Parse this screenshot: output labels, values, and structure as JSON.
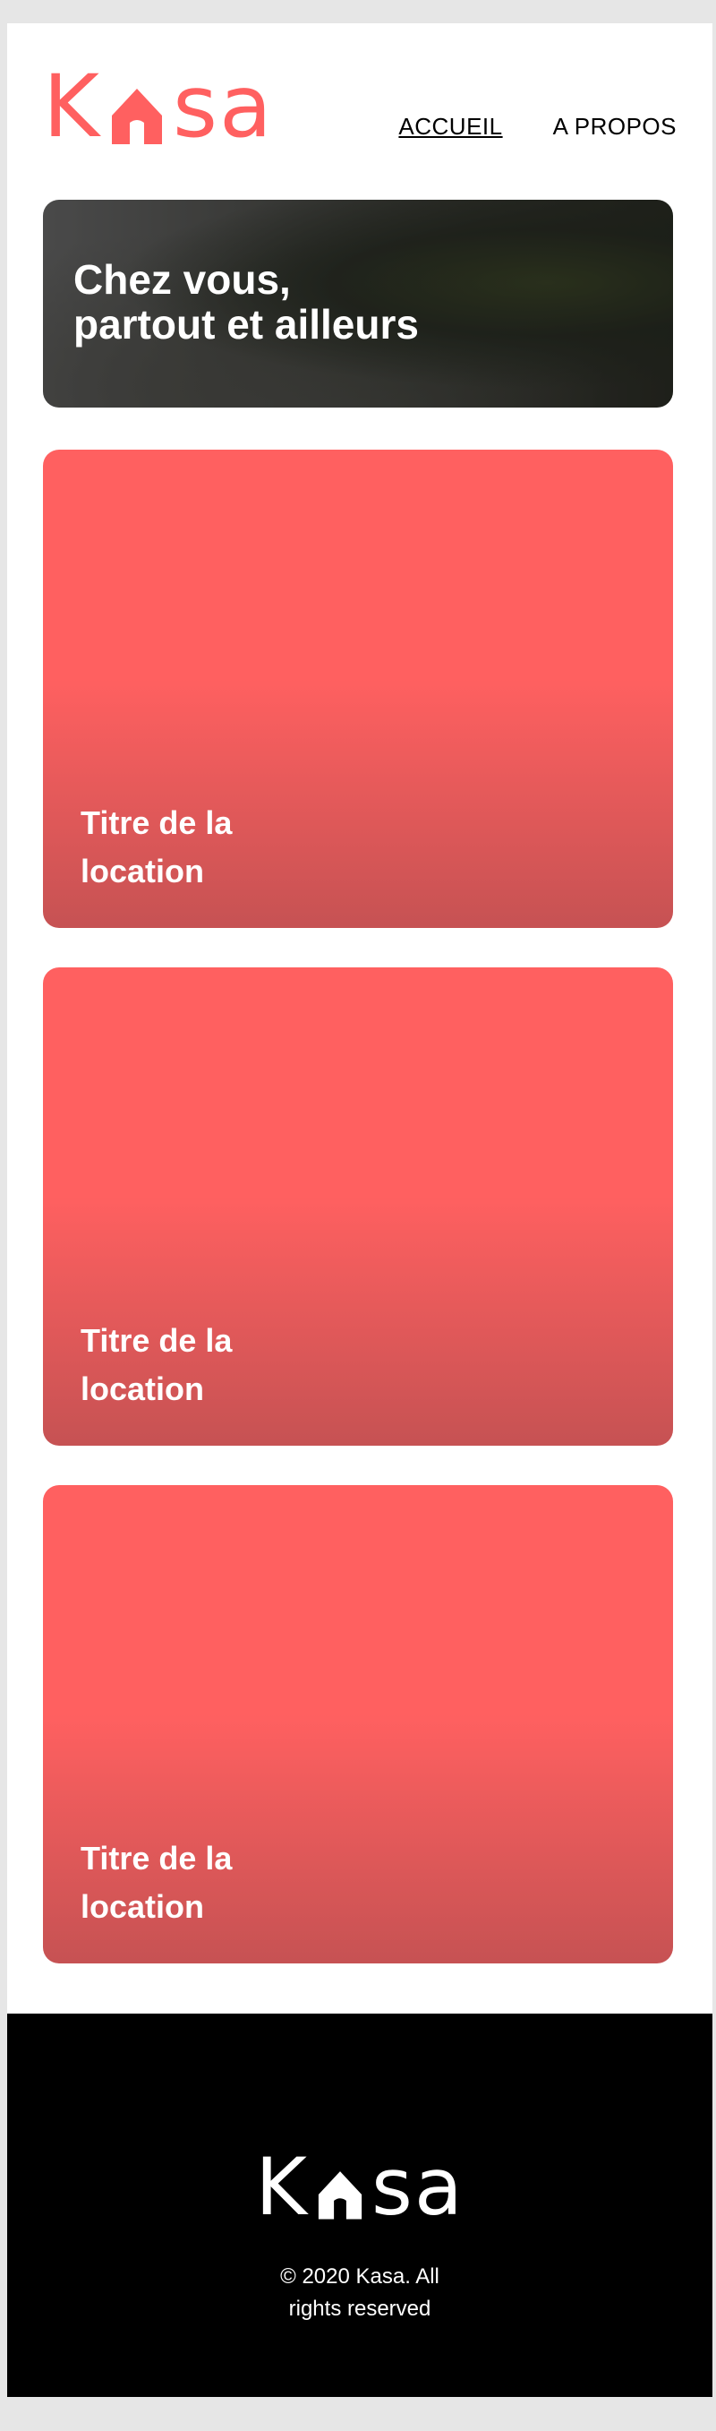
{
  "header": {
    "logo": {
      "letter_before": "K",
      "letters_after": "sa",
      "icon": "house-icon",
      "color": "#ff6060"
    },
    "nav": [
      {
        "label": "ACCUEIL",
        "active": true
      },
      {
        "label": "A PROPOS",
        "active": false
      }
    ]
  },
  "banner": {
    "title_line1": "Chez vous,",
    "title_line2": "partout et ailleurs"
  },
  "cards": [
    {
      "title": "Titre de la location"
    },
    {
      "title": "Titre de la location"
    },
    {
      "title": "Titre de la location"
    }
  ],
  "footer": {
    "logo": {
      "letter_before": "K",
      "letters_after": "sa",
      "icon": "house-icon",
      "color": "#ffffff"
    },
    "copyright_line1": "© 2020 Kasa. All",
    "copyright_line2": "rights reserved"
  },
  "colors": {
    "brand": "#ff6060",
    "card_gradient_end": "#c65253",
    "footer_bg": "#000000"
  }
}
